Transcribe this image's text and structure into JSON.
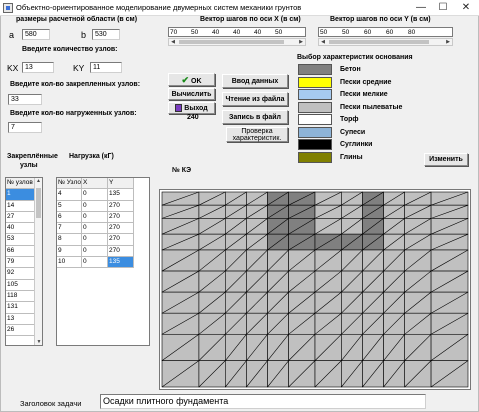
{
  "window": {
    "title": "Объектно-ориентированное моделирование двумерных систем механики грунтов",
    "minimize": "—",
    "maximize": "☐",
    "close": "✕"
  },
  "domain": {
    "heading": "размеры расчетной области (в см)",
    "a_label": "a",
    "a_value": "580",
    "b_label": "b",
    "b_value": "530"
  },
  "nodes": {
    "heading": "Введите количество узлов:",
    "kx_label": "KX",
    "kx_value": "13",
    "ky_label": "KY",
    "ky_value": "11"
  },
  "fixed_nodes": {
    "heading": "Введите кол-во закрепленных узлов:",
    "value": "33"
  },
  "loaded_nodes": {
    "heading": "Введите кол-во нагруженных узлов:",
    "value": "7"
  },
  "vector_x": {
    "label": "Вектор шагов по оси X (в см)",
    "values": [
      "70",
      "50",
      "40",
      "40",
      "40",
      "50"
    ]
  },
  "vector_y": {
    "label": "Вектор шагов по оси Y (в см)",
    "values": [
      "50",
      "50",
      "60",
      "60",
      "80",
      ""
    ]
  },
  "buttons": {
    "ok": "OK",
    "compute": "Вычислить",
    "exit": "Выход",
    "counter": "240",
    "data_input": "Ввод данных",
    "read_file": "Чтение из файла",
    "write_file": "Запись в файл",
    "check_line1": "Проверка",
    "check_line2": "характеристик.",
    "change": "Изменить"
  },
  "characteristics": {
    "heading": "Выбор характеристик основания",
    "items": [
      {
        "label": "Бетон",
        "color": "#808080"
      },
      {
        "label": "Пески средние",
        "color": "#ffff00"
      },
      {
        "label": "Пески мелкие",
        "color": "#a6caf0"
      },
      {
        "label": "Пески пылеватые",
        "color": "#c0c0c0"
      },
      {
        "label": "Торф",
        "color": "#ffffff"
      },
      {
        "label": "Супеси",
        "color": "#8eb4d8"
      },
      {
        "label": "Суглинки",
        "color": "#000000"
      },
      {
        "label": "Глины",
        "color": "#808000"
      }
    ]
  },
  "fixed_table": {
    "heading_line1": "Закреплённые",
    "heading_line2": "узлы",
    "header": "№ узлов",
    "rows": [
      "1",
      "14",
      "27",
      "40",
      "53",
      "66",
      "79",
      "92",
      "105",
      "118",
      "131",
      "13",
      "26"
    ]
  },
  "load_table": {
    "heading": "Нагрузка (кГ)",
    "headers": [
      "№ Узлов",
      "X",
      "Y"
    ],
    "rows": [
      [
        "4",
        "0",
        "135"
      ],
      [
        "5",
        "0",
        "270"
      ],
      [
        "6",
        "0",
        "270"
      ],
      [
        "7",
        "0",
        "270"
      ],
      [
        "8",
        "0",
        "270"
      ],
      [
        "9",
        "0",
        "270"
      ],
      [
        "10",
        "0",
        "135"
      ]
    ]
  },
  "mesh": {
    "label": "№ КЭ",
    "fill_color": "#c0c0c0",
    "dark_color": "#808080"
  },
  "task": {
    "label": "Заголовок задачи",
    "value": "Осадки плитного фундамента"
  }
}
